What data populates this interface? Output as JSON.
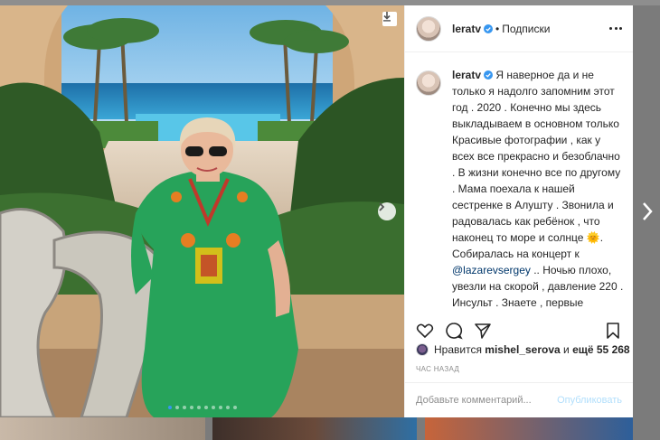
{
  "post": {
    "username": "leratv",
    "follow_label": "Подписки",
    "separator": "•",
    "caption_username": "leratv",
    "caption_text_1": "Я наверное да и не только я надолго запомним этот год . 2020 . Конечно мы здесь выкладываем в основном только Красивые фотографии , как у всех все прекрасно и безоблачно . В жизни конечно все по другому . Мама поехала к нашей сестренке в Алушту . Звонила и радовалась как ребёнок , что наконец то море и солнце 🌞. Собиралась на концерт к ",
    "caption_mention": "@lazarevsergey",
    "caption_text_2": " .. Ночью плохо, увезли на скорой , давление 220 . Инсульт . Знаете , первые секунды начинаешь глотать воздух и ничего не соображаешь . Сегодня я уже как- то пришла в себя , есть план действий . Нас ждёт долгий путь к восстановлению , но мы справимся . Мамуля люблю тебя сильно ."
  },
  "likes": {
    "prefix": "Нравится",
    "user": "mishel_serova",
    "connector": "и",
    "count_text": "ещё 55 268"
  },
  "timestamp": "час назад",
  "comment": {
    "placeholder": "Добавьте комментарий...",
    "post_label": "Опубликовать"
  },
  "carousel": {
    "total": 10,
    "active": 1
  },
  "colors": {
    "accent": "#3897f0",
    "link": "#00376b",
    "post_button_disabled": "#b2dffc",
    "verified": "#3897f0",
    "dress": "#27a35a"
  },
  "icons": [
    "download-icon",
    "chevron-right-icon",
    "verified-badge-icon",
    "more-icon",
    "heart-icon",
    "comment-icon",
    "share-icon",
    "bookmark-icon"
  ]
}
